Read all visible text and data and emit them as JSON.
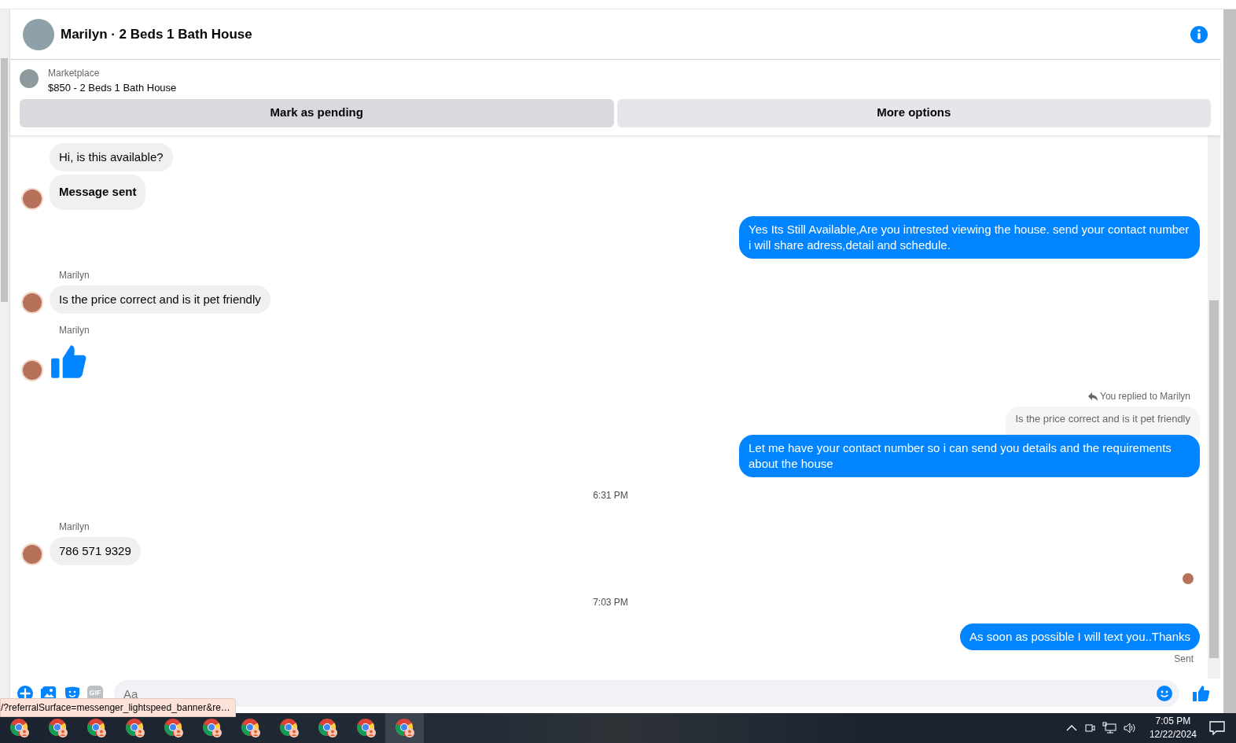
{
  "header": {
    "title": "Marilyn · 2 Beds 1 Bath House"
  },
  "listing": {
    "label": "Marketplace",
    "title": "$850 - 2 Beds 1 Bath House"
  },
  "actions": [
    "Mark as pending",
    "More options"
  ],
  "messages": [
    {
      "kind": "incoming",
      "text": "Hi, is this available?",
      "bold": false,
      "avatar": false
    },
    {
      "kind": "incoming",
      "text": "Message sent",
      "bold": true,
      "avatar": true
    },
    {
      "kind": "outgoing",
      "text": "Yes Its Still Available,Are you intrested viewing the house. send your contact number i will share adress,detail and schedule."
    },
    {
      "kind": "sender",
      "text": "Marilyn"
    },
    {
      "kind": "incoming",
      "text": "Is the price correct and is it pet friendly",
      "bold": false,
      "avatar": true
    },
    {
      "kind": "sender",
      "text": "Marilyn"
    },
    {
      "kind": "like",
      "avatar": true
    },
    {
      "kind": "reply_note",
      "text": "You replied to Marilyn"
    },
    {
      "kind": "quote",
      "text": "Is the price correct and is it pet friendly"
    },
    {
      "kind": "outgoing",
      "text": "Let me have your contact number so i can send you details and the requirements about the house"
    },
    {
      "kind": "time",
      "text": "6:31 PM"
    },
    {
      "kind": "sender",
      "text": "Marilyn"
    },
    {
      "kind": "incoming",
      "text": "786 571 9329",
      "bold": false,
      "avatar": true
    },
    {
      "kind": "seen"
    },
    {
      "kind": "time",
      "text": "7:03 PM"
    },
    {
      "kind": "outgoing",
      "text": "As soon as possible I will text you..Thanks"
    },
    {
      "kind": "status",
      "text": "Sent"
    }
  ],
  "composer": {
    "gif_label": "GIF",
    "placeholder": "Aa"
  },
  "link_preview": "/?referralSurface=messenger_lightspeed_banner&re…",
  "taskbar": {
    "apps": [
      {
        "selected": false
      },
      {
        "selected": false
      },
      {
        "selected": false
      },
      {
        "selected": false
      },
      {
        "selected": false
      },
      {
        "selected": false
      },
      {
        "selected": false
      },
      {
        "selected": false
      },
      {
        "selected": false
      },
      {
        "selected": false
      },
      {
        "selected": true
      }
    ],
    "time": "7:05 PM",
    "date": "12/22/2024"
  }
}
